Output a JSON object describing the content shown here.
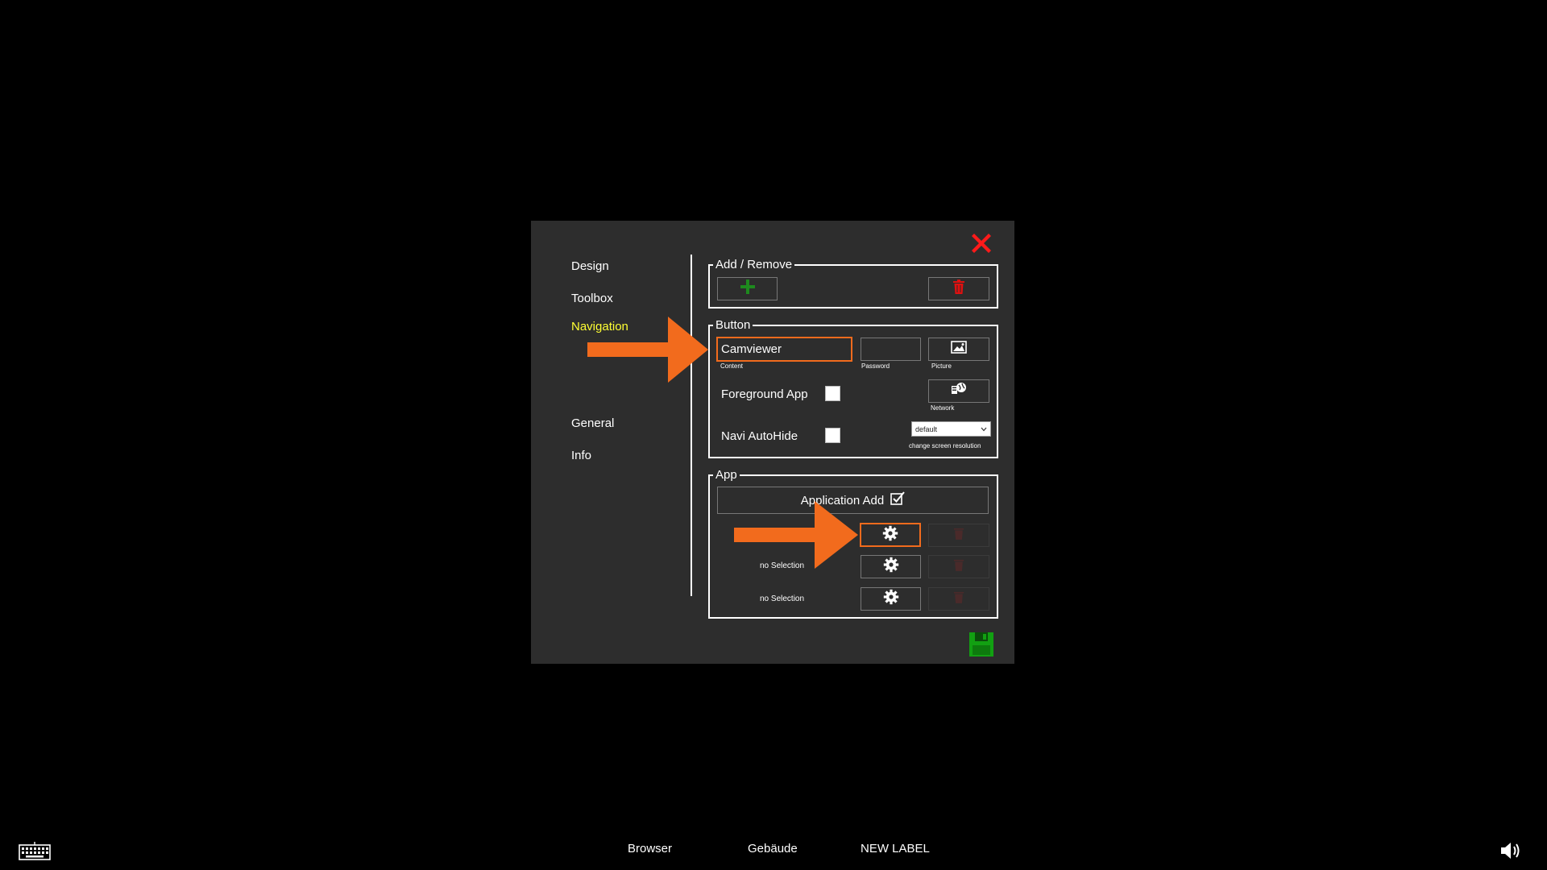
{
  "sidebar": {
    "items": [
      {
        "label": "Design"
      },
      {
        "label": "Toolbox"
      },
      {
        "label": "Navigation"
      },
      {
        "label": "General"
      },
      {
        "label": "Info"
      }
    ]
  },
  "add_remove": {
    "title": "Add / Remove"
  },
  "button_group": {
    "title": "Button",
    "content_value": "Camviewer",
    "content_label": "Content",
    "password_label": "Password",
    "picture_label": "Picture",
    "network_label": "Network",
    "foreground_label": "Foreground App",
    "autohide_label": "Navi AutoHide",
    "resolution_value": "default",
    "resolution_label": "change screen resolution"
  },
  "app_group": {
    "title": "App",
    "add_label": "Application Add",
    "rows": [
      {
        "selection": ""
      },
      {
        "selection": "no Selection"
      },
      {
        "selection": "no Selection"
      }
    ]
  },
  "taskbar": {
    "items": [
      "Browser",
      "Gebäude",
      "NEW LABEL"
    ]
  },
  "colors": {
    "accent_highlight": "#f26b1d",
    "active_nav": "#ffff33",
    "add_green": "#1e8a1e",
    "delete_red": "#e01010",
    "save_green": "#12a012"
  }
}
